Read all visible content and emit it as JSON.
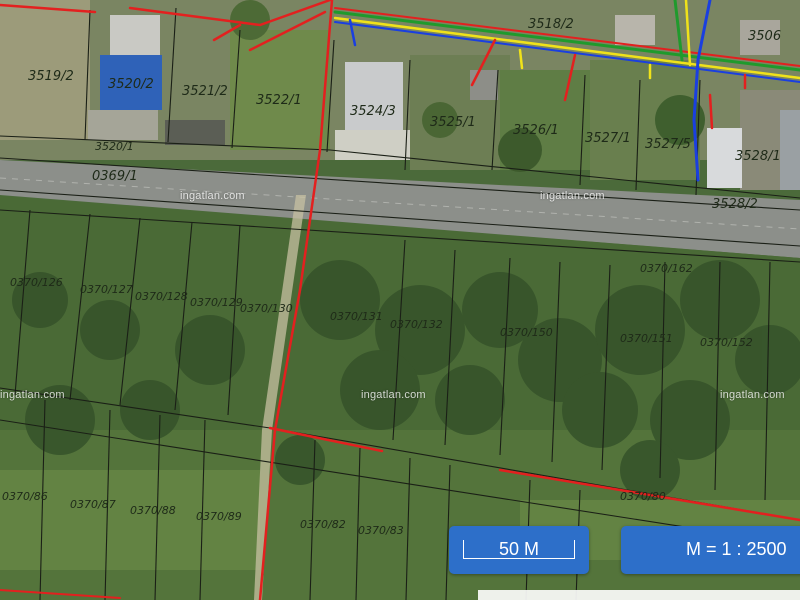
{
  "watermark_text": "ingatlan.com",
  "scale": {
    "label": "50 M",
    "ratio": "M = 1 : 2500"
  },
  "parcels": {
    "p3519": "3519/2",
    "p3520": "3520/2",
    "p3521": "3521/2",
    "p3522": "3522/1",
    "p3524": "3524/3",
    "p3525": "3525/1",
    "p3526": "3526/1",
    "p3527a": "3527/1",
    "p3527b": "3527/5",
    "p3528": "3528/1",
    "p3520b": "3520/1",
    "p3518": "3518/2",
    "p3506": "3506",
    "p0369": "0369/1",
    "p3528b": "3528/2",
    "p0370a": "0370/126",
    "p0370b": "0370/127",
    "p0370c": "0370/128",
    "p0370d": "0370/129",
    "p0370e": "0370/130",
    "p0370f": "0370/131",
    "p0370g": "0370/132",
    "p0370h": "0370/150",
    "p0370i": "0370/151",
    "p0370j": "0370/152",
    "p0370k": "0370/162",
    "p0370l": "0370/86",
    "p0370m": "0370/87",
    "p0370n": "0370/88",
    "p0370o": "0370/89",
    "p0370p": "0370/82",
    "p0370q": "0370/83",
    "p0370r": "0370/80"
  },
  "colors": {
    "utility_red": "#e3201f",
    "utility_blue": "#1a3fe0",
    "utility_yellow": "#f0e21a",
    "utility_green": "#1f9a2c",
    "scale_blue": "#2d6fc9"
  }
}
